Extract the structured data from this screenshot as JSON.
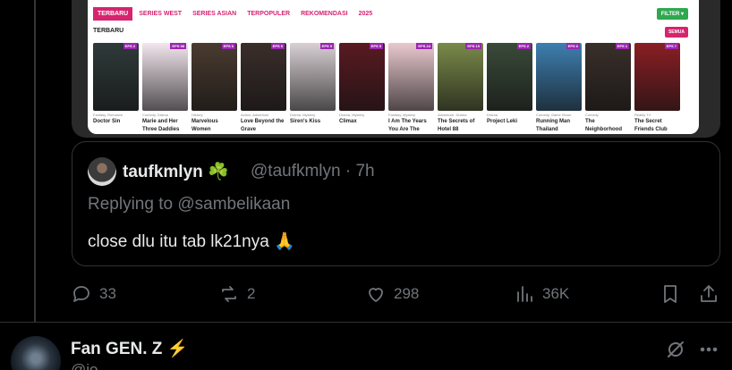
{
  "embedded_screenshot": {
    "tabs": [
      "TERBARU",
      "SERIES WEST",
      "SERIES ASIAN",
      "TERPOPULER",
      "REKOMENDASI",
      "2025"
    ],
    "filter_label": "FILTER ▾",
    "section_title": "TERBARU",
    "see_all_label": "SEMUA",
    "posters": [
      {
        "title": "Doctor Sin",
        "genre": "Fantasy, Romance",
        "eps": "EPS\n2",
        "color": "#2f3a3a"
      },
      {
        "title": "Marie and Her Three Daddies",
        "genre": "Comedy, Drama",
        "eps": "EPS\n98",
        "color": "#f3e6ee"
      },
      {
        "title": "Marvelous Women",
        "genre": "History",
        "eps": "EPS\n6",
        "color": "#4a3b30"
      },
      {
        "title": "Love Beyond the Grave",
        "genre": "Action, Adventure",
        "eps": "EPS\n9",
        "color": "#3a2e2a"
      },
      {
        "title": "Siren's Kiss",
        "genre": "Drama, Mystery",
        "eps": "EPS\n9",
        "color": "#d8d0d4"
      },
      {
        "title": "Climax",
        "genre": "Drama, Mystery",
        "eps": "EPS\n5",
        "color": "#5a1a22"
      },
      {
        "title": "I Am The Years You Are The Stars",
        "genre": "Fantasy, Mystery",
        "eps": "EPS\n24",
        "color": "#e9c9cf"
      },
      {
        "title": "The Secrets of Hotel 88",
        "genre": "Adventure, Drama",
        "eps": "EPS\n19",
        "color": "#7a8a4a"
      },
      {
        "title": "Project Leki",
        "genre": "Drama",
        "eps": "EPS\n2",
        "color": "#3a4a3a"
      },
      {
        "title": "Running Man Thailand",
        "genre": "Comedy, Game Show",
        "eps": "EPS\n6",
        "color": "#3e7fb0"
      },
      {
        "title": "The Neighborhood",
        "genre": "Comedy",
        "eps": "EPS\n1",
        "color": "#3a2f2a"
      },
      {
        "title": "The Secret Friends Club",
        "genre": "Reality TV",
        "eps": "EPS\n7",
        "color": "#8a1f24"
      }
    ]
  },
  "quote": {
    "name": "taufkmlyn ☘️",
    "handle": "@taufkmlyn · 7h",
    "replying_to": "Replying to @sambelikaan",
    "text": "close dlu itu tab lk21nya 🙏"
  },
  "actions": {
    "replies": "33",
    "reposts": "2",
    "likes": "298",
    "views": "36K"
  },
  "next_tweet": {
    "name": "Fan GEN. Z ⚡",
    "handle": "@jo...."
  }
}
